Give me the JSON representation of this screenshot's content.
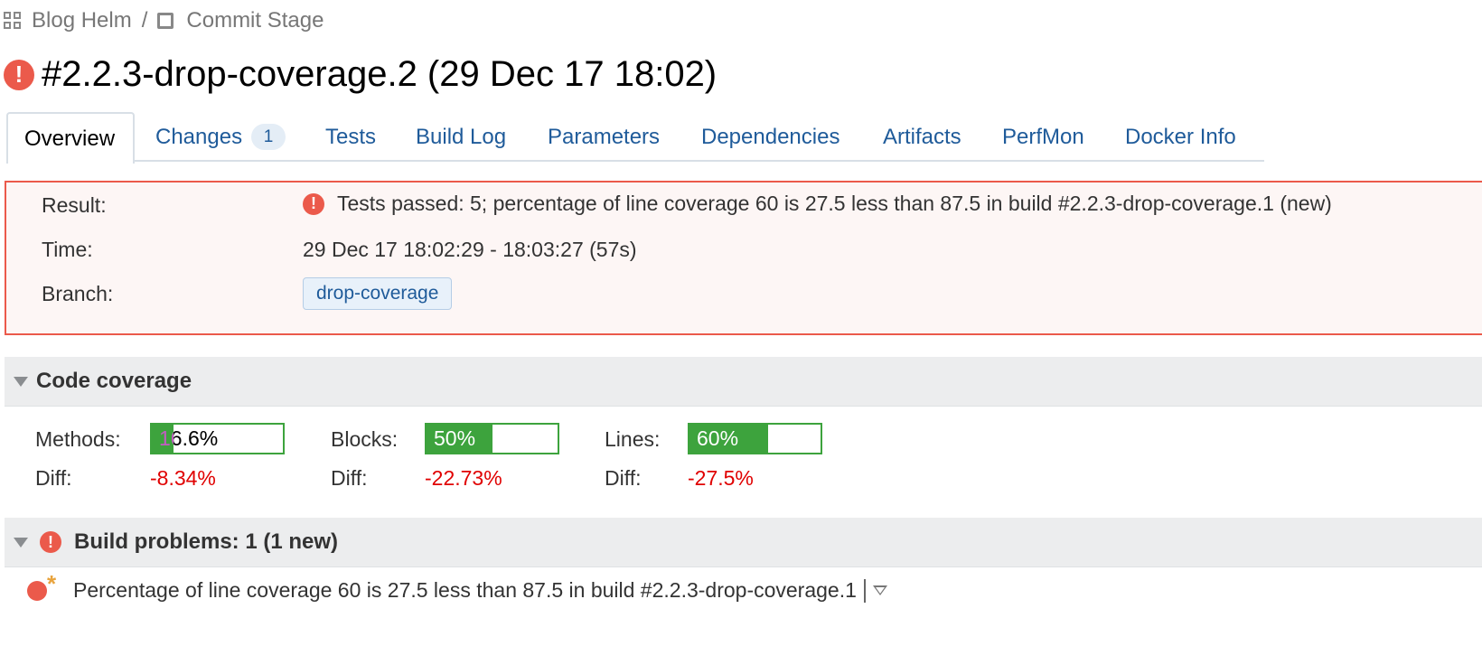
{
  "breadcrumb": {
    "project": "Blog Helm",
    "separator": "/",
    "build_config": "Commit Stage"
  },
  "build": {
    "title": "#2.2.3-drop-coverage.2 (29 Dec 17 18:02)"
  },
  "tabs": [
    {
      "label": "Overview",
      "active": true
    },
    {
      "label": "Changes",
      "count": "1"
    },
    {
      "label": "Tests"
    },
    {
      "label": "Build Log"
    },
    {
      "label": "Parameters"
    },
    {
      "label": "Dependencies"
    },
    {
      "label": "Artifacts"
    },
    {
      "label": "PerfMon"
    },
    {
      "label": "Docker Info"
    }
  ],
  "result": {
    "result_label": "Result:",
    "result_text": "Tests passed: 5; percentage of line coverage 60 is 27.5 less than 87.5 in build #2.2.3-drop-coverage.1 (new)",
    "time_label": "Time:",
    "time_text": "29 Dec 17 18:02:29 - 18:03:27 (57s)",
    "branch_label": "Branch:",
    "branch_name": "drop-coverage"
  },
  "code_coverage": {
    "title": "Code coverage",
    "methods": {
      "label": "Methods:",
      "value": "16.6%",
      "fraction": 0.166,
      "diff_label": "Diff:",
      "diff": "-8.34%"
    },
    "blocks": {
      "label": "Blocks:",
      "value": "50%",
      "fraction": 0.5,
      "diff_label": "Diff:",
      "diff": "-22.73%"
    },
    "lines": {
      "label": "Lines:",
      "value": "60%",
      "fraction": 0.6,
      "diff_label": "Diff:",
      "diff": "-27.5%"
    }
  },
  "build_problems": {
    "title": "Build problems: 1 (1 new)",
    "items": [
      {
        "text": "Percentage of line coverage 60 is 27.5 less than 87.5 in build #2.2.3-drop-coverage.1",
        "new_marker": "*"
      }
    ]
  },
  "colors": {
    "error": "#eb5a4b",
    "link": "#1f5b9a",
    "coverage_green": "#3da33d",
    "diff_red": "#e00000"
  }
}
